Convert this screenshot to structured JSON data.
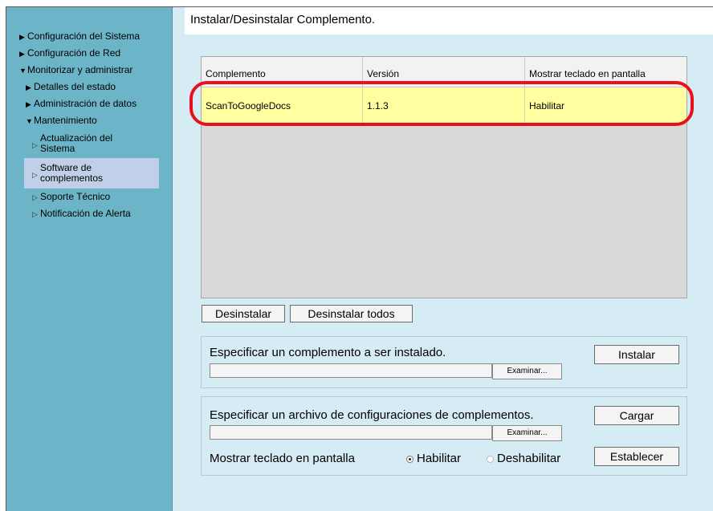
{
  "page": {
    "title": "Instalar/Desinstalar Complemento."
  },
  "sidebar": {
    "items": [
      {
        "label": "Configuración del Sistema"
      },
      {
        "label": "Configuración de Red"
      },
      {
        "label": "Monitorizar y administrar"
      },
      {
        "label": "Detalles del estado"
      },
      {
        "label": "Administración de datos"
      },
      {
        "label": "Mantenimiento"
      },
      {
        "label_line1": "Actualización del",
        "label_line2": "Sistema"
      },
      {
        "label_line1": "Software de",
        "label_line2": "complementos"
      },
      {
        "label": "Soporte Técnico"
      },
      {
        "label": "Notificación de Alerta"
      }
    ]
  },
  "table": {
    "headers": [
      "Complemento",
      "Versión",
      "Mostrar teclado en pantalla"
    ],
    "rows": [
      [
        "ScanToGoogleDocs",
        "1.1.3",
        "Habilitar"
      ]
    ]
  },
  "actions": {
    "uninstall": "Desinstalar",
    "uninstall_all": "Desinstalar todos"
  },
  "install_panel": {
    "label": "Especificar un complemento a ser instalado.",
    "file_value": "",
    "browse": "Examinar...",
    "install": "Instalar"
  },
  "config_panel": {
    "label": "Especificar un archivo de configuraciones de complementos.",
    "file_value": "",
    "browse": "Examinar...",
    "load": "Cargar",
    "keyboard_label": "Mostrar teclado en pantalla",
    "enable": "Habilitar",
    "disable": "Deshabilitar",
    "selected": "Habilitar",
    "set": "Establecer"
  },
  "colors": {
    "highlight": "#e8101a",
    "selected_row": "#ffffa0",
    "sidebar": "#6cb4c8"
  }
}
